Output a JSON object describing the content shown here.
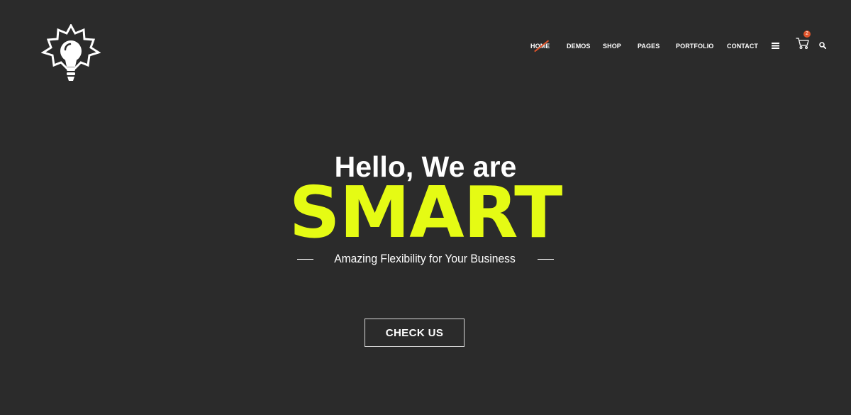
{
  "logo": {
    "icon": "lightbulb-burst-icon"
  },
  "nav": {
    "items": [
      {
        "label": "HOME",
        "active": true
      },
      {
        "label": "DEMOS",
        "active": false
      },
      {
        "label": "SHOP",
        "active": false
      },
      {
        "label": "PAGES",
        "active": false
      },
      {
        "label": "PORTFOLIO",
        "active": false
      },
      {
        "label": "CONTACT",
        "active": false
      }
    ],
    "menu_icon": "hamburger-icon",
    "cart_icon": "shopping-cart-icon",
    "cart_count": "2",
    "search_icon": "search-icon"
  },
  "hero": {
    "greeting": "Hello, We are",
    "title": "SMART",
    "tagline": "Amazing Flexibility for Your Business",
    "cta_label": "CHECK US"
  },
  "colors": {
    "background": "#2b2b2b",
    "accent": "#e5fb14",
    "active_marker": "#e0542b",
    "text": "#ffffff"
  }
}
